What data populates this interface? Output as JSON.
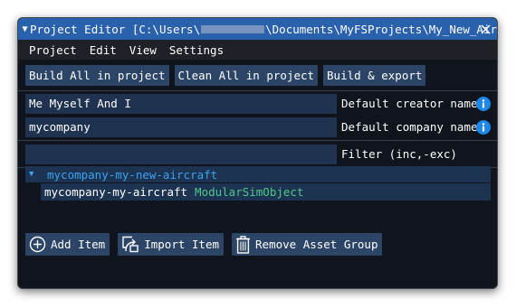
{
  "window": {
    "title_prefix": "Project Editor [C:\\Users\\",
    "title_suffix": "\\Documents\\MyFSProjects\\My_New_Air",
    "close_icon": "close-icon",
    "collapse_icon": "triangle-down-icon"
  },
  "menu": {
    "items": [
      "Project",
      "Edit",
      "View",
      "Settings"
    ]
  },
  "toolbar": {
    "build_all": "Build All in project",
    "clean_all": "Clean All in project",
    "build_export": "Build & export"
  },
  "fields": {
    "creator": {
      "value": "Me Myself And I",
      "label": "Default creator name",
      "info_icon": "info-icon"
    },
    "company": {
      "value": "mycompany",
      "label": "Default company name",
      "info_icon": "info-icon"
    },
    "filter": {
      "value": "",
      "label": "Filter (inc,-exc)"
    }
  },
  "tree": {
    "group": {
      "name": "mycompany-my-new-aircraft",
      "expanded": true
    },
    "items": [
      {
        "name": "mycompany-my-aircraft",
        "type": "ModularSimObject"
      }
    ]
  },
  "actions": {
    "add_item": "Add Item",
    "import_item": "Import Item",
    "remove_group": "Remove Asset Group"
  },
  "colors": {
    "title_bar": "#2a61ad",
    "button": "#2c4566",
    "input": "#1f3350",
    "tree_parent_text": "#3ba3f0",
    "asset_type_text": "#4fc98a",
    "info_icon": "#1b86ec"
  }
}
